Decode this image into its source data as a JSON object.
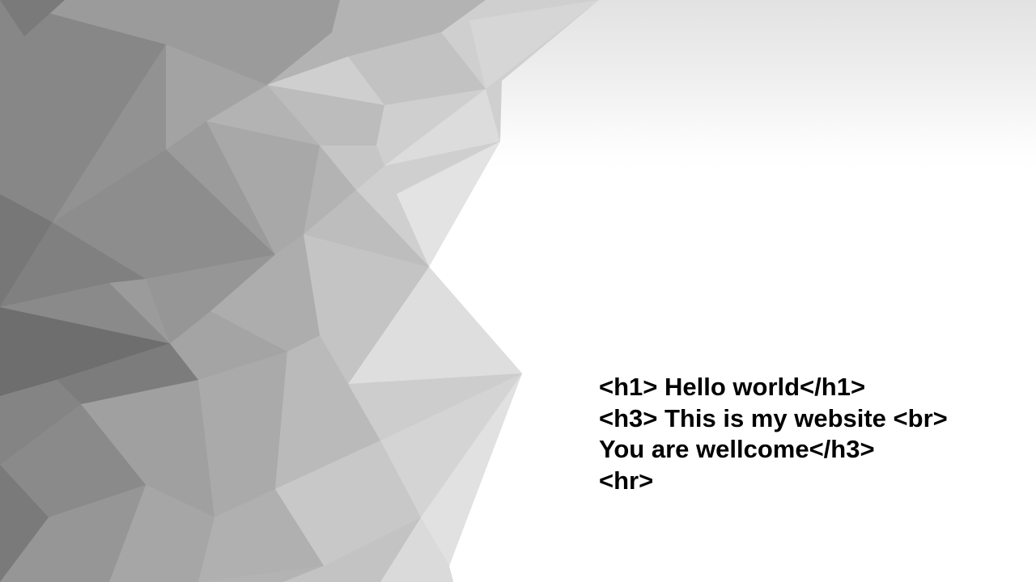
{
  "slide": {
    "lines": [
      "<h1> Hello world</h1>",
      "<h3> This is my website <br>",
      "You are wellcome</h3>",
      "<hr>"
    ]
  },
  "colors": {
    "text": "#000000",
    "background": "#ffffff",
    "polygon_dark": "#6e6e6e",
    "polygon_light": "#e6e6e6"
  },
  "decoration": {
    "background_art": "grey low-poly triangle pattern"
  }
}
